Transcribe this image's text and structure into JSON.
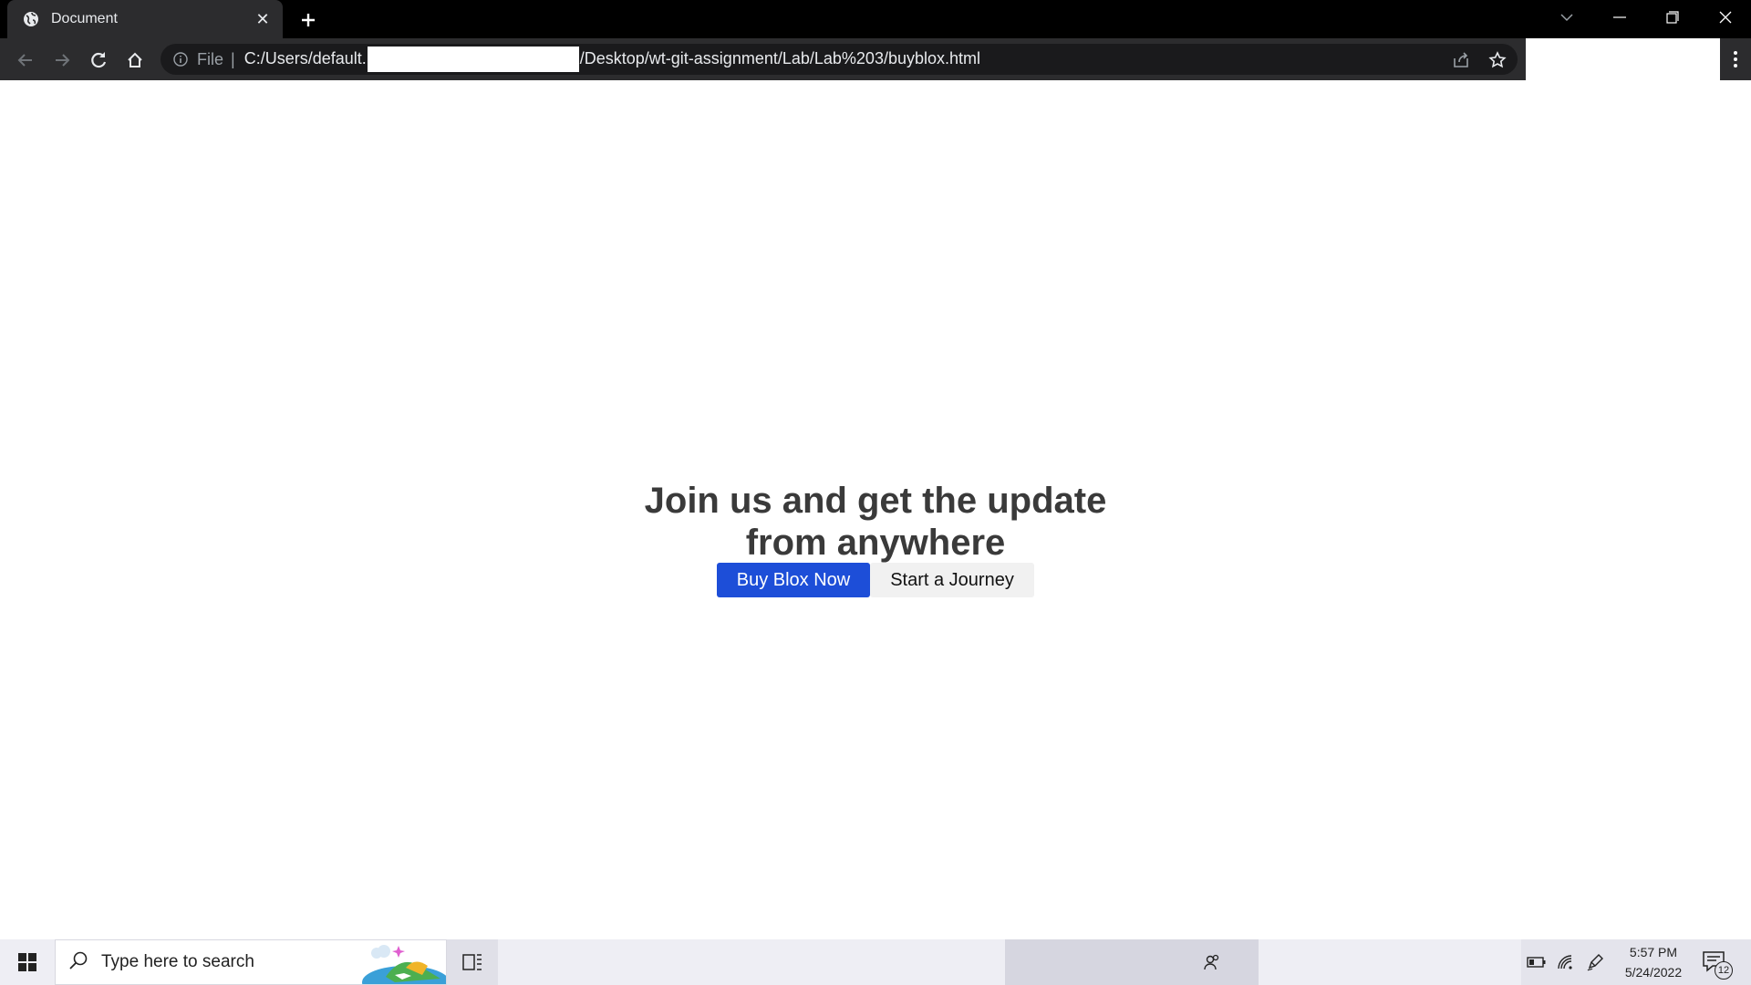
{
  "browser": {
    "tab": {
      "title": "Document",
      "close_glyph": "✕",
      "favicon": "globe-icon"
    },
    "new_tab_glyph": "+",
    "address_bar": {
      "scheme_label": "File",
      "separator": "|",
      "url_before_redaction": "C:/Users/default.",
      "url_after_redaction": "/Desktop/wt-git-assignment/Lab/Lab%203/buyblox.html"
    }
  },
  "page": {
    "heading": "Join us and get the update from anywhere",
    "primary_button": "Buy Blox Now",
    "secondary_button": "Start a Journey",
    "colors": {
      "primary": "#1d4ed8",
      "heading": "#3a3a3a",
      "secondary_bg": "#f1f1f1"
    }
  },
  "taskbar": {
    "search_placeholder": "Type here to search",
    "clock": {
      "time": "5:57 PM",
      "date": "5/24/2022"
    },
    "notification_count": "12"
  }
}
